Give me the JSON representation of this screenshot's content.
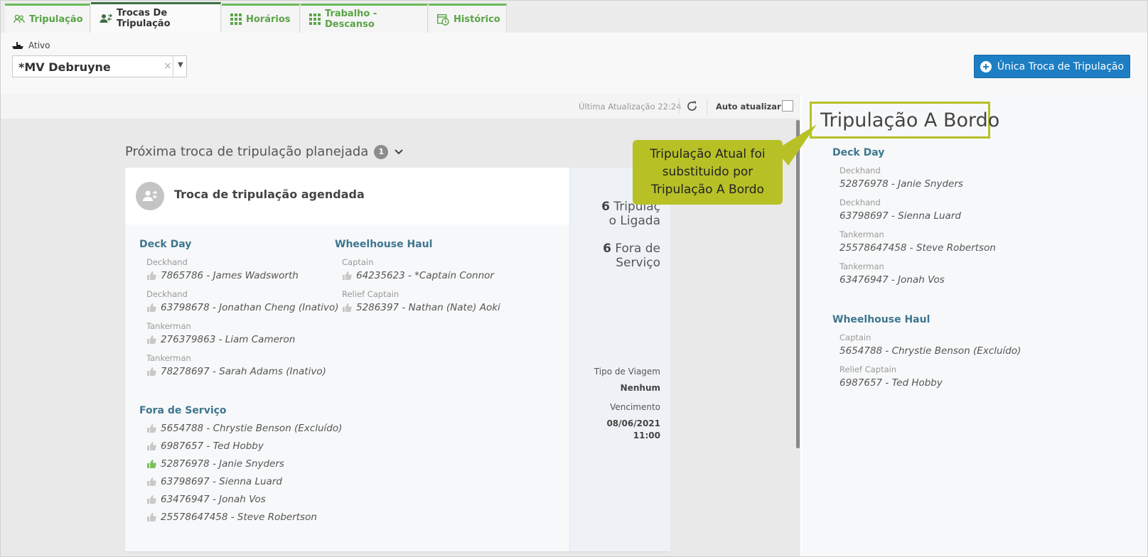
{
  "tabs": [
    {
      "label": "Tripulação",
      "icon": "crew-icon"
    },
    {
      "label": "Trocas De Tripulação",
      "icon": "crew-change-icon",
      "active": true
    },
    {
      "label": "Horários",
      "icon": "grid-icon"
    },
    {
      "label": "Trabalho - Descanso",
      "icon": "grid-icon"
    },
    {
      "label": "Histórico",
      "icon": "calendar-clock-icon"
    }
  ],
  "header": {
    "ativo_label": "Ativo",
    "vessel_value": "*MV Debruyne",
    "clear_symbol": "×",
    "dropdown_symbol": "▼",
    "unique_button": "Única Troca de Tripulação"
  },
  "toolbar": {
    "last_update": "Última Atualização 22:24",
    "auto_update_label": "Auto atualizar",
    "auto_update_checked": false
  },
  "planned": {
    "title": "Próxima troca de tripulação planejada",
    "count": "1"
  },
  "card": {
    "title": "Troca de tripulação agendada",
    "groups": [
      {
        "name": "Deck Day",
        "members": [
          {
            "role": "Deckhand",
            "person": "7865786 - James Wadsworth"
          },
          {
            "role": "Deckhand",
            "person": "63798678 - Jonathan Cheng (Inativo)"
          },
          {
            "role": "Tankerman",
            "person": "276379863 - Liam Cameron"
          },
          {
            "role": "Tankerman",
            "person": "78278697 - Sarah Adams (Inativo)"
          }
        ]
      },
      {
        "name": "Wheelhouse Haul",
        "members": [
          {
            "role": "Captain",
            "person": "64235623 - *Captain Connor"
          },
          {
            "role": "Relief Captain",
            "person": "5286397 - Nathan (Nate) Aoki"
          }
        ]
      }
    ],
    "off_service": {
      "title": "Fora de Serviço",
      "members": [
        {
          "person": "5654788 - Chrystie Benson (Excluído)",
          "active": false
        },
        {
          "person": "6987657 - Ted Hobby",
          "active": false
        },
        {
          "person": "52876978 - Janie Snyders",
          "active": true
        },
        {
          "person": "63798697 - Sienna Luard",
          "active": false
        },
        {
          "person": "63476947 - Jonah Vos",
          "active": false
        },
        {
          "person": "25578647458 - Steve Robertson",
          "active": false
        }
      ]
    },
    "side": {
      "crew_on_count": "6",
      "crew_on_line1": "Tripulaç",
      "crew_on_line2": "o Ligada",
      "off_count": "6",
      "off_line1": "Fora de",
      "off_line2": "Serviço",
      "trip_type_label": "Tipo de Viagem",
      "trip_type_value": "Nenhum",
      "due_label": "Vencimento",
      "due_date": "08/06/2021",
      "due_time": "11:00"
    }
  },
  "callout": {
    "line1": "Tripulação Atual foi",
    "line2": "substituido por",
    "line3": "Tripulação A Bordo"
  },
  "onboard": {
    "title": "Tripulação A Bordo",
    "groups": [
      {
        "name": "Deck Day",
        "members": [
          {
            "role": "Deckhand",
            "person": "52876978 - Janie Snyders"
          },
          {
            "role": "Deckhand",
            "person": "63798697 - Sienna Luard"
          },
          {
            "role": "Tankerman",
            "person": "25578647458 - Steve Robertson"
          },
          {
            "role": "Tankerman",
            "person": "63476947 - Jonah Vos"
          }
        ]
      },
      {
        "name": "Wheelhouse Haul",
        "members": [
          {
            "role": "Captain",
            "person": "5654788 - Chrystie Benson (Excluído)"
          },
          {
            "role": "Relief Captain",
            "person": "6987657 - Ted Hobby"
          }
        ]
      }
    ]
  },
  "colors": {
    "tab_accent": "#6cbb5a",
    "primary_button": "#1d7ec3",
    "group_title": "#3e7690",
    "callout": "#b7c126",
    "thumb_active": "#7cc05e",
    "thumb_inactive": "#c8c8c8"
  }
}
